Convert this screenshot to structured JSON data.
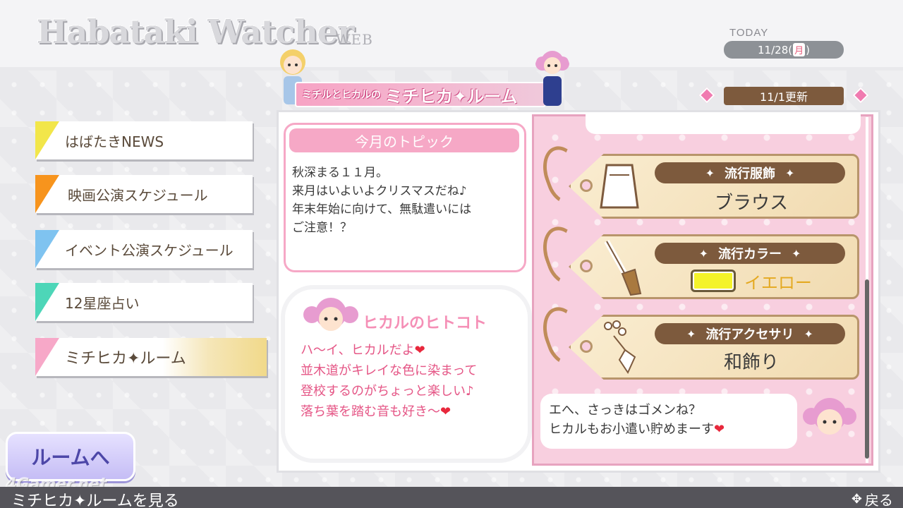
{
  "header": {
    "logo": "Habataki Watcher",
    "logo_suffix": "WEB",
    "today_label": "TODAY",
    "date": "11/28(",
    "day": "月",
    "date_close": ")"
  },
  "banner": {
    "small_text": "ミチルとヒカルの",
    "big_text": "ミチヒカ✦ルーム",
    "update": "11/1更新"
  },
  "menu": {
    "items": [
      {
        "label": "はばたきNEWS",
        "color": "#f2e64a"
      },
      {
        "label": "映画公演スケジュール",
        "color": "#f7941d"
      },
      {
        "label": "イベント公演スケジュール",
        "color": "#7fc3f0"
      },
      {
        "label": "12星座占い",
        "color": "#4dd6b8"
      },
      {
        "label": "ミチヒカ✦ルーム",
        "color": "#f7a8c8"
      }
    ],
    "room_button": "ルームへ"
  },
  "topic": {
    "title": "今月のトピック",
    "lines": [
      "秋深まる１１月。",
      "来月はいよいよクリスマスだね♪",
      "年末年始に向けて、無駄遣いには",
      "ご注意！？"
    ]
  },
  "hitokoto": {
    "title": "ヒカルのヒトコト",
    "lines": [
      "ハ～イ、ヒカルだよ",
      "並木道がキレイな色に染まって",
      "登校するのがちょっと楽しい♪",
      "落ち葉を踏む音も好き～"
    ],
    "heart": "❤"
  },
  "trends": [
    {
      "heading": "流行服飾",
      "value": "ブラウス",
      "icon": "blouse-icon"
    },
    {
      "heading": "流行カラー",
      "value": "イエロー",
      "icon": "brush-icon",
      "swatch": "#f4f32a"
    },
    {
      "heading": "流行アクセサリ",
      "value": "和飾り",
      "icon": "hair-ornament-icon"
    }
  ],
  "speech": {
    "line1": "エへ、さっきはゴメンね？",
    "line2": "ヒカルもお小遣い貯めまーす",
    "heart": "❤"
  },
  "footer": {
    "status": "ミチヒカ✦ルームを見る",
    "back": "戻る",
    "watermark": "4Gamer.net"
  }
}
